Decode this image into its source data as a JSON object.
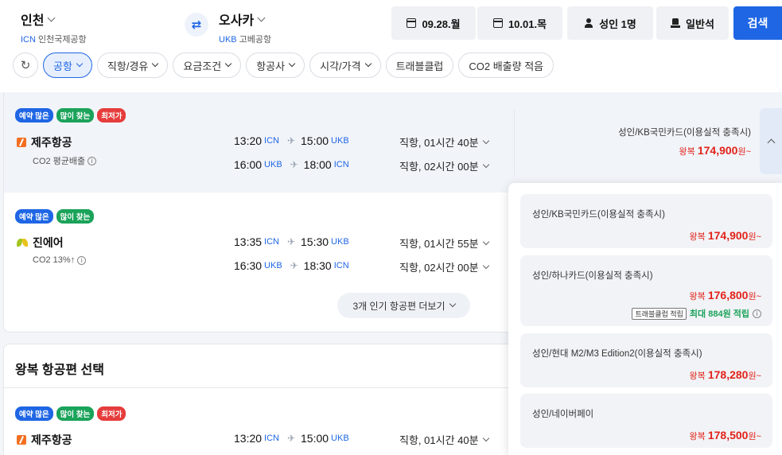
{
  "header": {
    "origin": {
      "city": "인천",
      "code": "ICN",
      "airport": "인천국제공항"
    },
    "destination": {
      "city": "오사카",
      "code": "UKB",
      "airport": "고베공항"
    },
    "swap_icon": "⇄",
    "depart_date": "09.28.월",
    "return_date": "10.01.목",
    "passengers": "성인 1명",
    "cabin": "일반석",
    "search_label": "검색"
  },
  "filters": {
    "refresh_icon": "↻",
    "chips": [
      "공항",
      "직항/경유",
      "요금조건",
      "항공사",
      "시각/가격",
      "트래블클럽",
      "CO2 배출량 적음"
    ],
    "active": "공항"
  },
  "badges": {
    "popular": "예약 많은",
    "searched": "많이 찾는",
    "cheapest": "최저가"
  },
  "flights": [
    {
      "airline": "제주항공",
      "co2": "CO2 평균배출",
      "out": {
        "dep": "13:20",
        "dep_ap": "ICN",
        "arr": "15:00",
        "arr_ap": "UKB",
        "dur": "직항, 01시간 40분"
      },
      "ret": {
        "dep": "16:00",
        "dep_ap": "UKB",
        "arr": "18:00",
        "arr_ap": "ICN",
        "dur": "직항, 02시간 00분"
      },
      "price_label": "성인/KB국민카드(이용실적 충족시)",
      "price_prefix": "왕복",
      "price": "174,900",
      "price_suffix": "원~"
    },
    {
      "airline": "진에어",
      "co2": "CO2 13%↑",
      "out": {
        "dep": "13:35",
        "dep_ap": "ICN",
        "arr": "15:30",
        "arr_ap": "UKB",
        "dur": "직항, 01시간 55분"
      },
      "ret": {
        "dep": "16:30",
        "dep_ap": "UKB",
        "arr": "18:30",
        "arr_ap": "ICN",
        "dur": "직항, 02시간 00분"
      }
    }
  ],
  "more_button": "3개 인기 항공편 더보기",
  "return_section": {
    "title": "왕복 항공편 선택",
    "airline": "제주항공",
    "out": {
      "dep": "13:20",
      "dep_ap": "ICN",
      "arr": "15:00",
      "arr_ap": "UKB",
      "dur": "직항, 01시간 40분"
    }
  },
  "price_options": [
    {
      "label": "성인/KB국민카드(이용실적 충족시)",
      "prefix": "왕복",
      "price": "174,900",
      "suffix": "원~"
    },
    {
      "label": "성인/하나카드(이용실적 충족시)",
      "prefix": "왕복",
      "price": "176,800",
      "suffix": "원~",
      "bonus_tag": "트래블클럽 적립",
      "bonus_text": "최대 884원 적립"
    },
    {
      "label": "성인/현대 M2/M3 Edition2(이용실적 충족시)",
      "prefix": "왕복",
      "price": "178,280",
      "suffix": "원~"
    },
    {
      "label": "성인/네이버페이",
      "prefix": "왕복",
      "price": "178,500",
      "suffix": "원~"
    }
  ],
  "colors": {
    "accent": "#1f66e5",
    "price": "#e2231a",
    "green": "#1ba35a"
  }
}
